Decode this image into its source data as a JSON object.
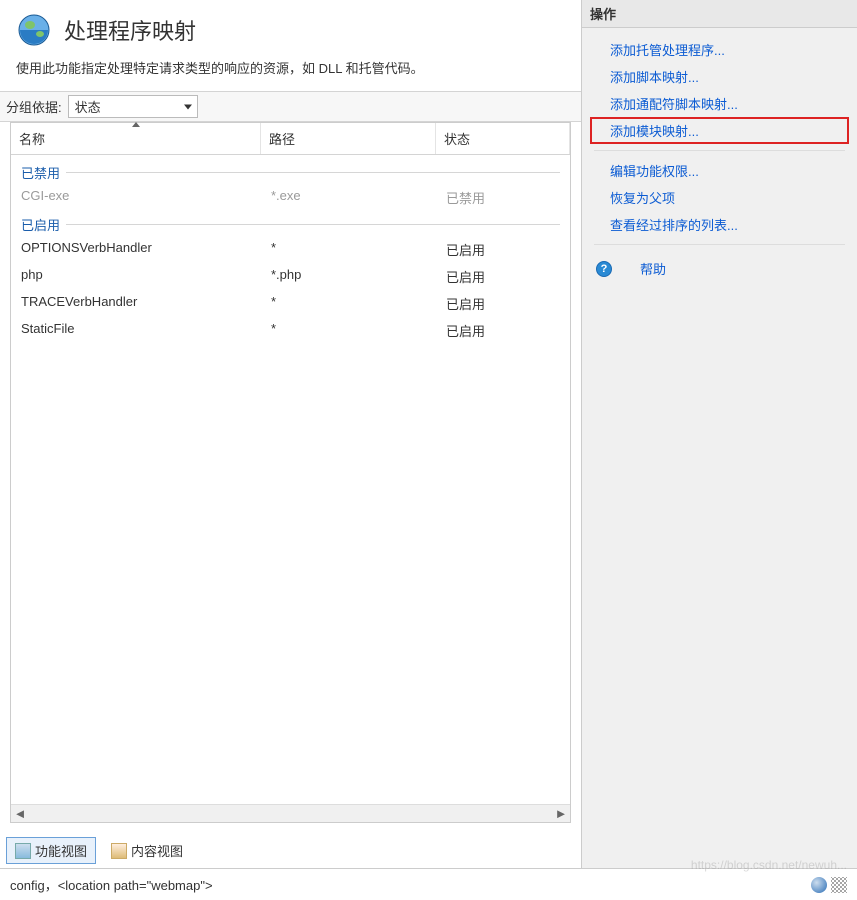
{
  "page": {
    "title": "处理程序映射",
    "description": "使用此功能指定处理特定请求类型的响应的资源，如 DLL 和托管代码。"
  },
  "groupby": {
    "label": "分组依据:",
    "value": "状态"
  },
  "columns": {
    "name": "名称",
    "path": "路径",
    "state": "状态"
  },
  "groups": [
    {
      "label": "已禁用",
      "disabled": true,
      "rows": [
        {
          "name": "CGI-exe",
          "path": "*.exe",
          "state": "已禁用"
        }
      ]
    },
    {
      "label": "已启用",
      "disabled": false,
      "rows": [
        {
          "name": "OPTIONSVerbHandler",
          "path": "*",
          "state": "已启用"
        },
        {
          "name": "php",
          "path": "*.php",
          "state": "已启用"
        },
        {
          "name": "TRACEVerbHandler",
          "path": "*",
          "state": "已启用"
        },
        {
          "name": "StaticFile",
          "path": "*",
          "state": "已启用"
        }
      ]
    }
  ],
  "view_tabs": {
    "features": "功能视图",
    "content": "内容视图"
  },
  "status_bar": {
    "text": "config，<location path=\"webmap\">"
  },
  "actions": {
    "header": "操作",
    "links_top": [
      {
        "key": "add-managed",
        "label": "添加托管处理程序...",
        "highlight": false
      },
      {
        "key": "add-script",
        "label": "添加脚本映射...",
        "highlight": false
      },
      {
        "key": "add-wildcard",
        "label": "添加通配符脚本映射...",
        "highlight": false
      },
      {
        "key": "add-module",
        "label": "添加模块映射...",
        "highlight": true
      }
    ],
    "links_mid": [
      {
        "key": "edit-perm",
        "label": "编辑功能权限..."
      },
      {
        "key": "revert-parent",
        "label": "恢复为父项"
      },
      {
        "key": "view-ordered",
        "label": "查看经过排序的列表..."
      }
    ],
    "help": "帮助"
  },
  "watermark": "https://blog.csdn.net/newuh..."
}
